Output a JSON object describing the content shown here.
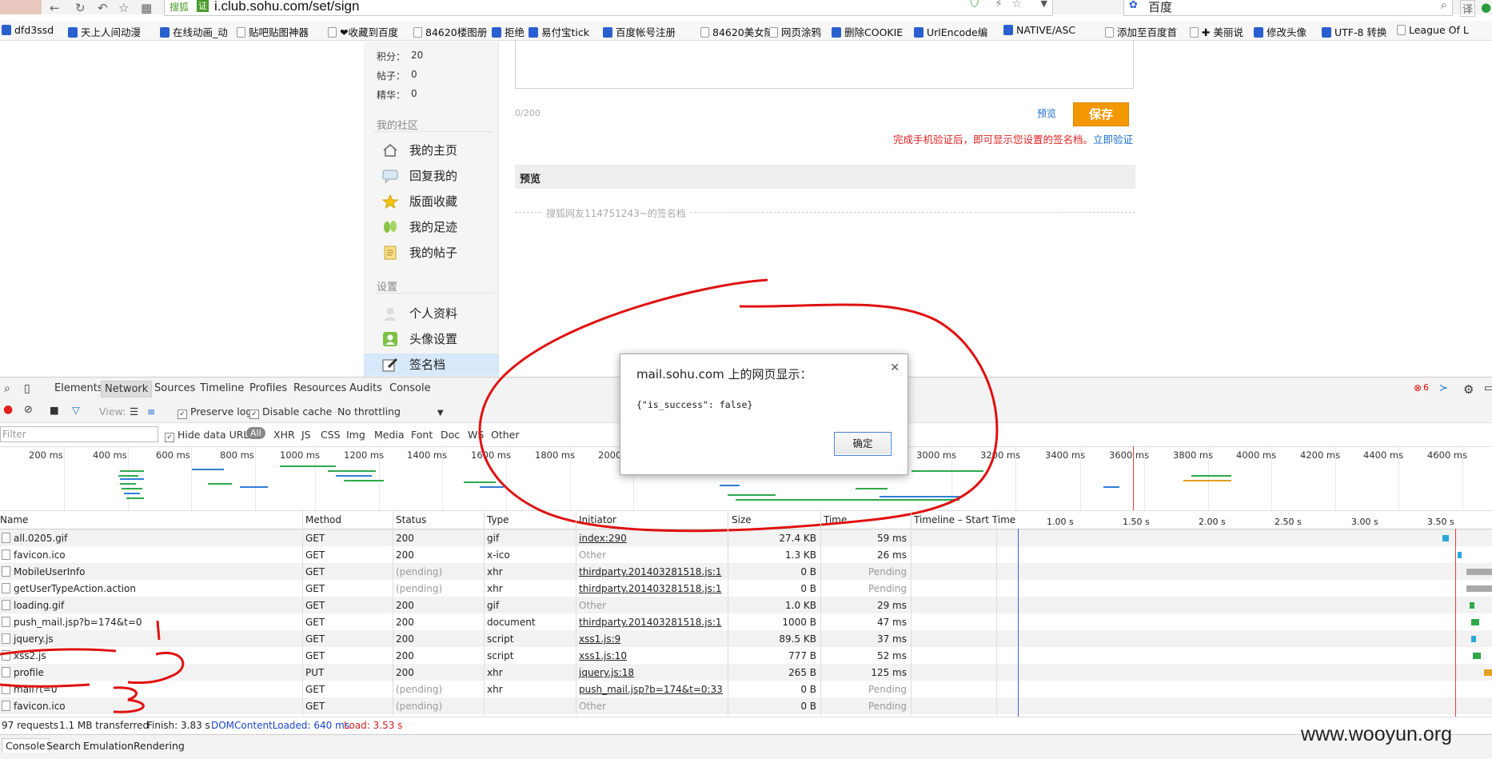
{
  "browser": {
    "search_engine_label": "搜狐",
    "secure_label": "证",
    "url": "i.club.sohu.com/set/sign",
    "search_text": "百度",
    "toolbar_extra": "译"
  },
  "bookmarks": [
    "dfd3ssd",
    "天上人间动漫",
    "在线动画_动",
    "贴吧贴图神器",
    "❤收藏到百度",
    "84620楼图册",
    "拒绝",
    "易付宝tick",
    "百度帐号注册",
    "84620美女随",
    "网页涂鸦",
    "删除COOKIE",
    "UrlEncode编",
    "NATIVE/ASC",
    "添加至百度首",
    "✚ 美丽说",
    "修改头像",
    "UTF-8 转换",
    "League Of L"
  ],
  "sidebar": {
    "stats": [
      {
        "label": "积分：",
        "value": "20"
      },
      {
        "label": "帖子：",
        "value": "0"
      },
      {
        "label": "精华：",
        "value": "0"
      }
    ],
    "section_community": "我的社区",
    "community_items": [
      "我的主页",
      "回复我的",
      "版面收藏",
      "我的足迹",
      "我的帖子"
    ],
    "section_settings": "设置",
    "settings_items": [
      "个人资料",
      "头像设置",
      "签名档"
    ]
  },
  "signature": {
    "counter": "0/200",
    "preview_link": "预览",
    "save_label": "保存",
    "notice": "完成手机验证后，即可显示您设置的签名档。",
    "verify_link": "立即验证",
    "preview_title": "预览",
    "preview_text": "搜狐网友114751243~的签名档"
  },
  "devtools": {
    "tabs": [
      "Elements",
      "Network",
      "Sources",
      "Timeline",
      "Profiles",
      "Resources",
      "Audits",
      "Console"
    ],
    "error_count": "6",
    "controls": {
      "view_label": "View:",
      "preserve_log": "Preserve log",
      "disable_cache": "Disable cache",
      "throttling": "No throttling"
    },
    "filter_placeholder": "Filter",
    "hide_data_urls": "Hide data URLs",
    "type_filters": [
      "All",
      "XHR",
      "JS",
      "CSS",
      "Img",
      "Media",
      "Font",
      "Doc",
      "WS",
      "Other"
    ],
    "overview_ticks": [
      "200 ms",
      "400 ms",
      "600 ms",
      "800 ms",
      "1000 ms",
      "1200 ms",
      "1400 ms",
      "1600 ms",
      "1800 ms",
      "2000",
      "3000 ms",
      "3200 ms",
      "3400 ms",
      "3600 ms",
      "3800 ms",
      "4000 ms",
      "4200 ms",
      "4400 ms",
      "4600 ms"
    ],
    "columns": [
      "Name",
      "Method",
      "Status",
      "Type",
      "Initiator",
      "Size",
      "Time",
      "Timeline – Start Time"
    ],
    "timeline_ticks": [
      "1.00 s",
      "1.50 s",
      "2.00 s",
      "2.50 s",
      "3.00 s",
      "3.50 s"
    ],
    "rows": [
      {
        "name": "all.0205.gif",
        "method": "GET",
        "status": "200",
        "type": "gif",
        "initiator": "index:290",
        "size": "27.4 KB",
        "time": "59 ms"
      },
      {
        "name": "favicon.ico",
        "method": "GET",
        "status": "200",
        "type": "x-ico",
        "initiator": "Other",
        "size": "1.3 KB",
        "time": "26 ms"
      },
      {
        "name": "MobileUserInfo",
        "method": "GET",
        "status": "(pending)",
        "type": "xhr",
        "initiator": "thirdparty.201403281518.js:1",
        "size": "0 B",
        "time": "Pending"
      },
      {
        "name": "getUserTypeAction.action",
        "method": "GET",
        "status": "(pending)",
        "type": "xhr",
        "initiator": "thirdparty.201403281518.js:1",
        "size": "0 B",
        "time": "Pending"
      },
      {
        "name": "loading.gif",
        "method": "GET",
        "status": "200",
        "type": "gif",
        "initiator": "Other",
        "size": "1.0 KB",
        "time": "29 ms"
      },
      {
        "name": "push_mail.jsp?b=174&t=0",
        "method": "GET",
        "status": "200",
        "type": "document",
        "initiator": "thirdparty.201403281518.js:1",
        "size": "1000 B",
        "time": "47 ms"
      },
      {
        "name": "jquery.js",
        "method": "GET",
        "status": "200",
        "type": "script",
        "initiator": "xss1.js:9",
        "size": "89.5 KB",
        "time": "37 ms"
      },
      {
        "name": "xss2.js",
        "method": "GET",
        "status": "200",
        "type": "script",
        "initiator": "xss1.js:10",
        "size": "777 B",
        "time": "52 ms"
      },
      {
        "name": "profile",
        "method": "PUT",
        "status": "200",
        "type": "xhr",
        "initiator": "jquery.js:18",
        "size": "265 B",
        "time": "125 ms"
      },
      {
        "name": "mail?t=0",
        "method": "GET",
        "status": "(pending)",
        "type": "xhr",
        "initiator": "push_mail.jsp?b=174&t=0:33",
        "size": "0 B",
        "time": "Pending"
      },
      {
        "name": "favicon.ico",
        "method": "GET",
        "status": "(pending)",
        "type": "",
        "initiator": "Other",
        "size": "0 B",
        "time": "Pending"
      }
    ],
    "status": {
      "requests": "97 requests",
      "transferred": "1.1 MB transferred",
      "finish": "Finish: 3.83 s",
      "dcl": "DOMContentLoaded: 640 ms",
      "load": "Load: 3.53 s"
    },
    "drawer_tabs": [
      "Console",
      "Search",
      "Emulation",
      "Rendering"
    ]
  },
  "dialog": {
    "title": "mail.sohu.com 上的网页显示：",
    "message": "{\"is_success\": false}",
    "ok_label": "确定"
  },
  "watermark": "www.wooyun.org",
  "colors": {
    "accent_save": "#f39800",
    "annotation": "#e01010",
    "link": "#1a6bc9"
  }
}
